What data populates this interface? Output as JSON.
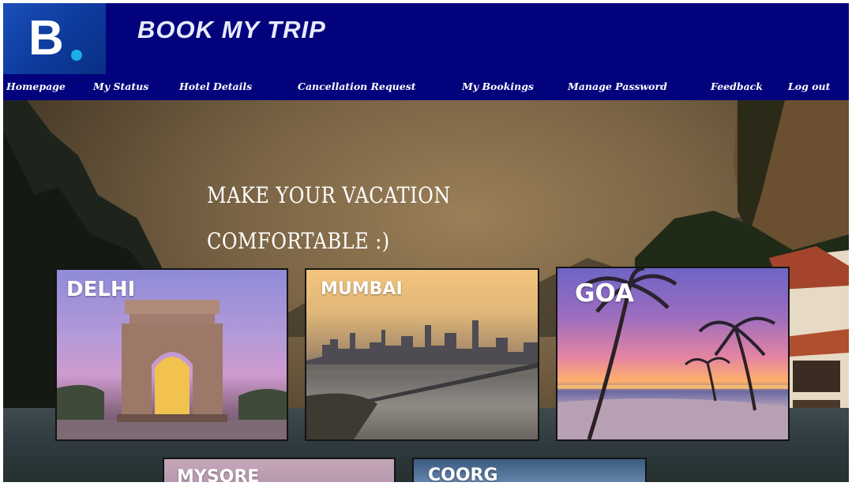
{
  "header": {
    "logo_letter": "B",
    "title": "BOOK MY TRIP",
    "background_color": "#02027c"
  },
  "nav": {
    "items": [
      {
        "label": "Homepage"
      },
      {
        "label": "My Status"
      },
      {
        "label": "Hotel Details"
      },
      {
        "label": "Cancellation Request"
      },
      {
        "label": "My Bookings"
      },
      {
        "label": "Manage Password"
      },
      {
        "label": "Feedback"
      },
      {
        "label": "Log out"
      }
    ]
  },
  "hero": {
    "tagline_line1": "MAKE YOUR VACATION",
    "tagline_line2": "COMFORTABLE :)"
  },
  "destinations": [
    {
      "label": "DELHI"
    },
    {
      "label": "MUMBAI"
    },
    {
      "label": "GOA"
    },
    {
      "label": "MYSORE"
    },
    {
      "label": "COORG"
    }
  ]
}
